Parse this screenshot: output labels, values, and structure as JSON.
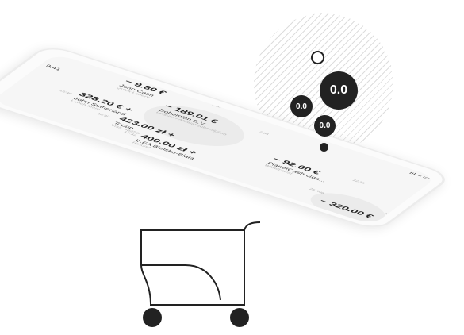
{
  "status_bar": {
    "time": "9:41",
    "signal": "ııl ≈ ▭"
  },
  "transactions": [
    {
      "amount": "− 9.80 €",
      "name": "John Cash",
      "sub": "Quick Lottery",
      "time": "7:50"
    },
    {
      "amount": "− 189.01 €",
      "name": "Bohemian B.V.",
      "sub": "Leisure / Annual subscription",
      "time": "7:34"
    },
    {
      "amount": "328.20 € +",
      "name": "John Sutherland",
      "sub": "Lunch team",
      "time": "16:40"
    },
    {
      "amount": "423.00 zł +",
      "name": "Topup",
      "sub": "Visa ••8250",
      "time": "12:30"
    },
    {
      "amount": "400.00 zł +",
      "name": "IKEA Bielsko-Biała",
      "sub": "Refund",
      "time": "17:32"
    },
    {
      "amount": "− 92.00 €",
      "name": "PlanetCash Gda...",
      "sub": "Withdrawal",
      "time": "22:18"
    },
    {
      "amount": "− 320.00 €",
      "name": "",
      "sub": "",
      "time": "9:13"
    }
  ],
  "date_divider": "26 Aug",
  "bubbles": {
    "large": "0.0",
    "mid": "0.0",
    "small": "0.0"
  },
  "colors": {
    "ink": "#222222",
    "phone": "#fbfbfb",
    "screen": "#f6f6f6"
  }
}
